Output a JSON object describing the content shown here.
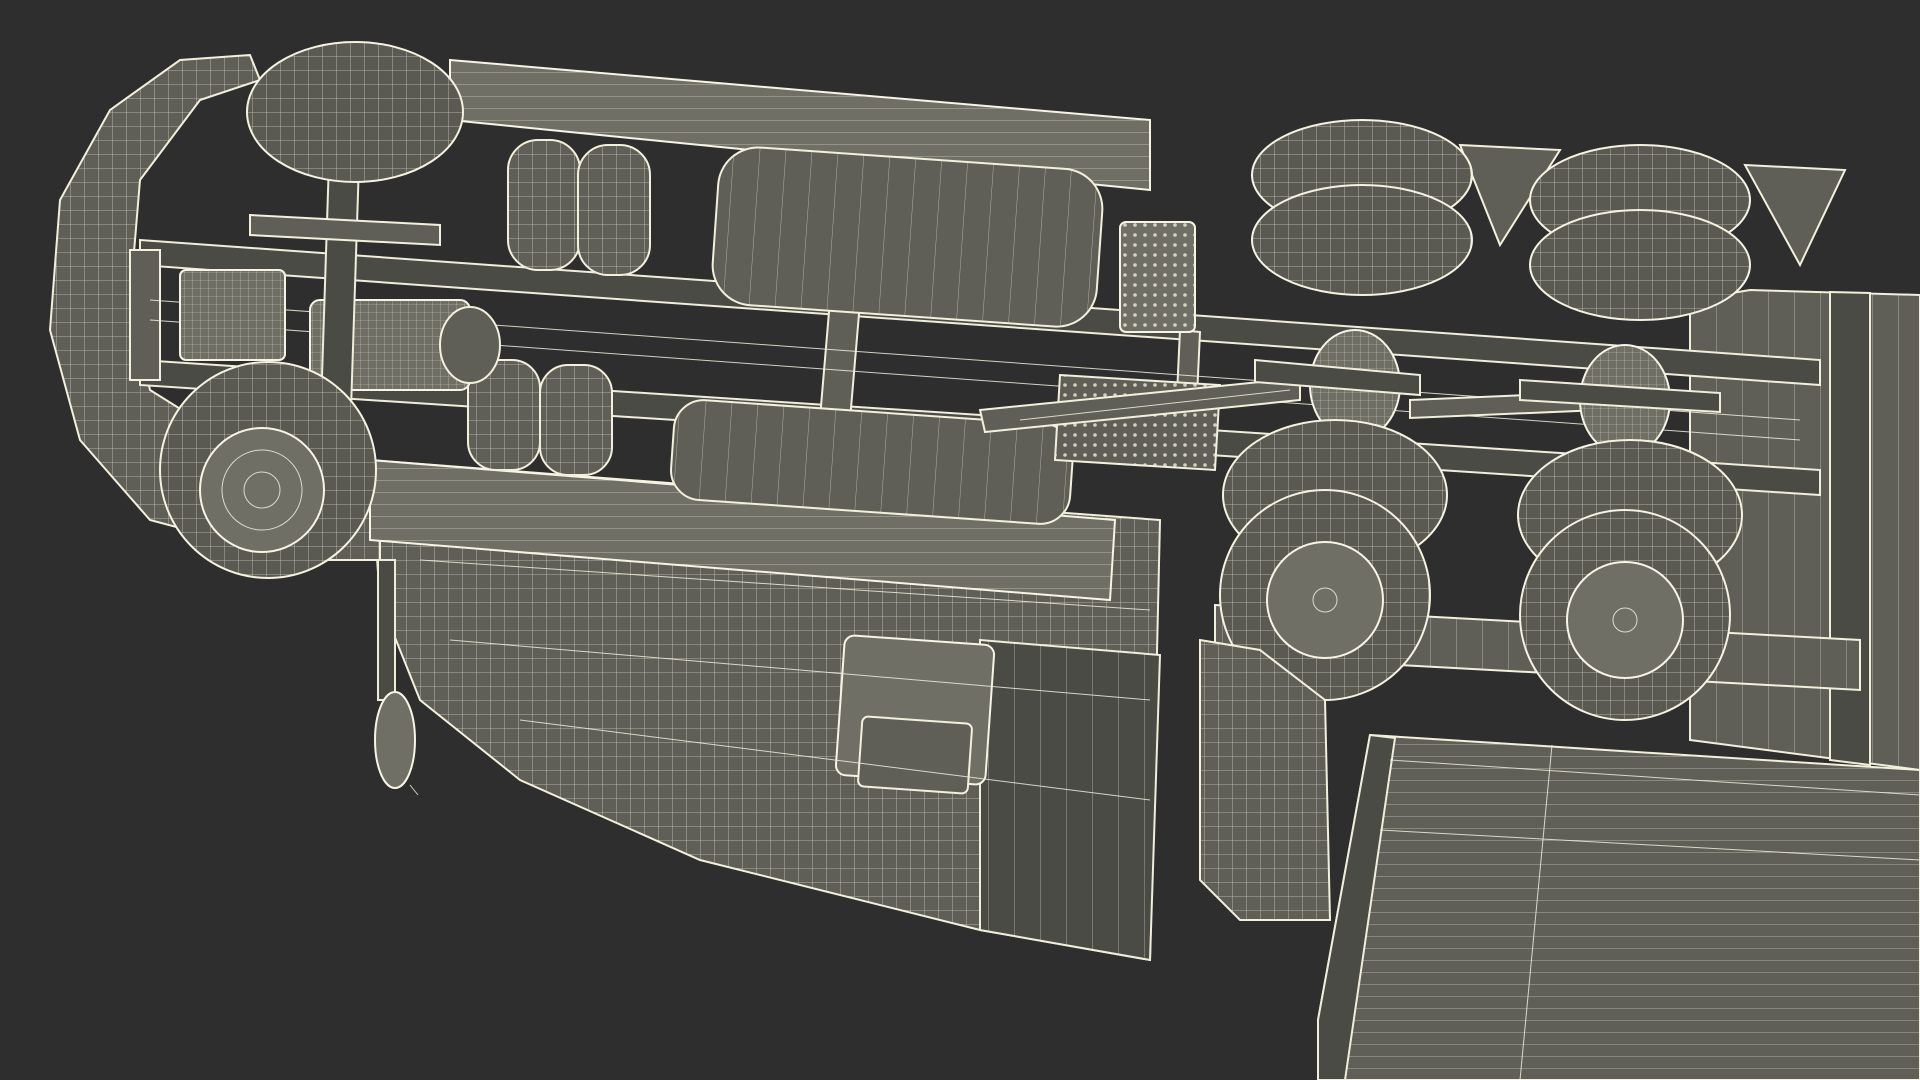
{
  "image": {
    "subject": "truck-underside-wireframe-render",
    "colors": {
      "background": "#2e2e2e",
      "mesh_fill": "#5f5f57",
      "mesh_line": "#f2f0dc"
    }
  }
}
